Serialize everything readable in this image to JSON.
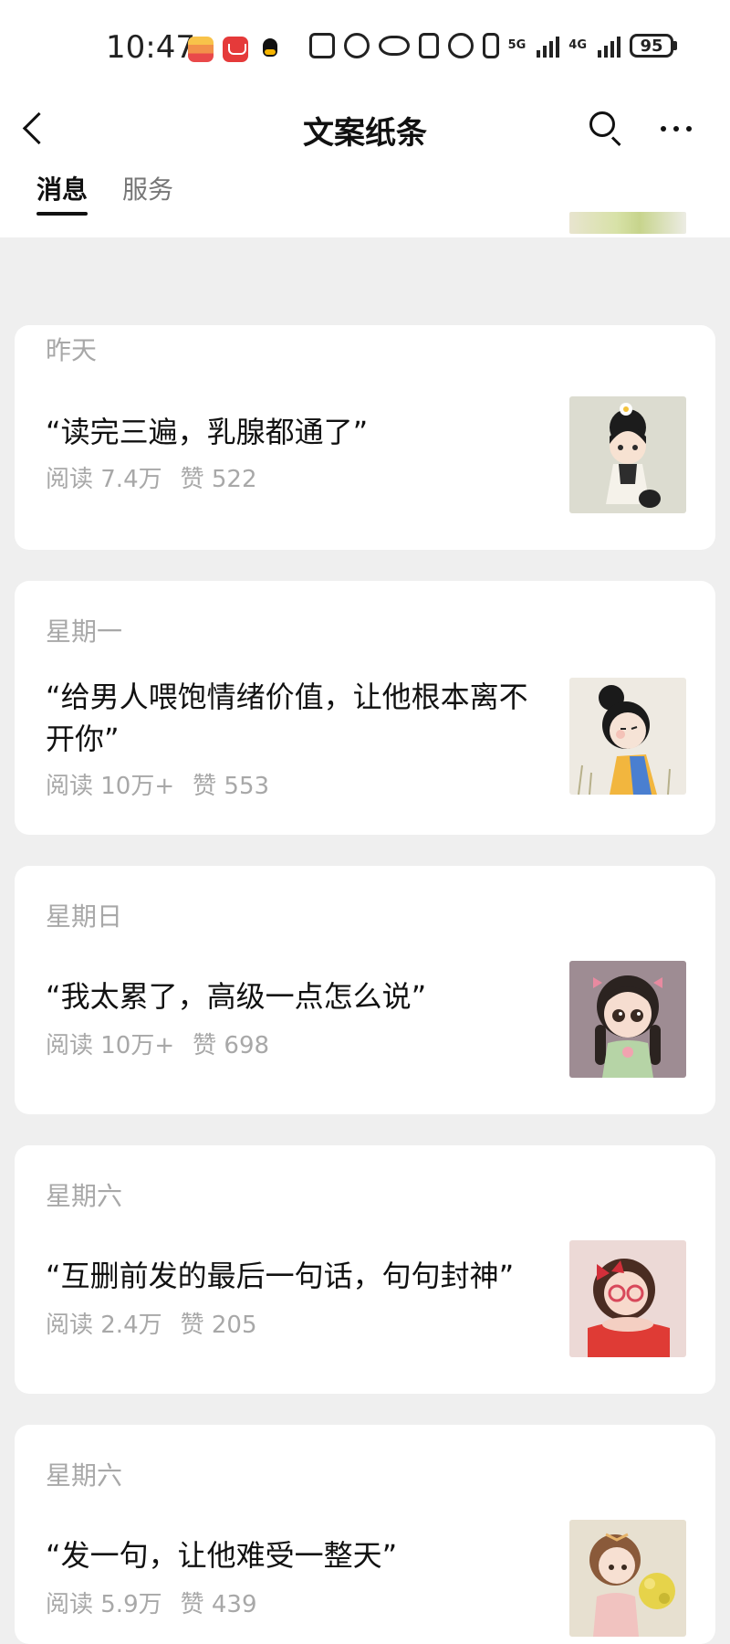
{
  "status_bar": {
    "time": "10:47",
    "network_5g": "5G",
    "network_4g": "4G",
    "battery": "95"
  },
  "nav": {
    "title": "文案纸条"
  },
  "tabs": [
    {
      "label": "消息",
      "active": true
    },
    {
      "label": "服务",
      "active": false
    }
  ],
  "articles": [
    {
      "day": "昨天",
      "title": "“读完三遍，乳腺都通了”",
      "reads": "阅读 7.4万",
      "likes": "赞 522",
      "thumb_icon": "girl-with-flower-illustration"
    },
    {
      "day": "星期一",
      "title": "“给男人喂饱情绪价值，让他根本离不开你”",
      "reads": "阅读 10万+",
      "likes": "赞 553",
      "thumb_icon": "pouting-girl-illustration"
    },
    {
      "day": "星期日",
      "title": "“我太累了，高级一点怎么说”",
      "reads": "阅读 10万+",
      "likes": "赞 698",
      "thumb_icon": "doll-girl-with-braids"
    },
    {
      "day": "星期六",
      "title": "“互删前发的最后一句话，句句封神”",
      "reads": "阅读 2.4万",
      "likes": "赞 205",
      "thumb_icon": "girl-with-glasses"
    },
    {
      "day": "星期六",
      "title": "“发一句，让他难受一整天”",
      "reads": "阅读 5.9万",
      "likes": "赞 439",
      "thumb_icon": "girl-with-flowers"
    }
  ]
}
